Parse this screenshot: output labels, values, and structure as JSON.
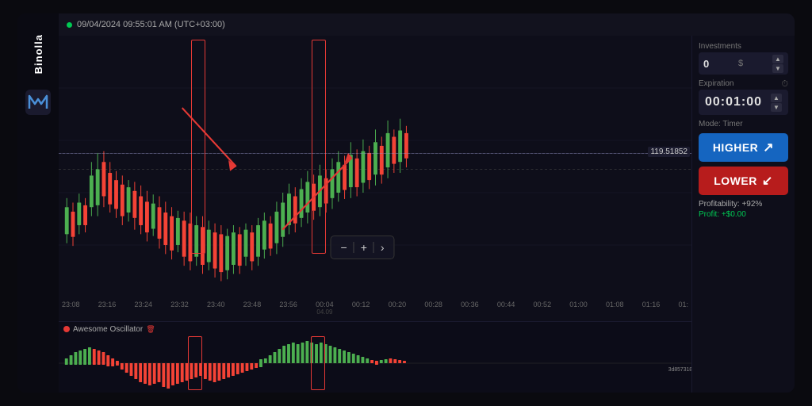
{
  "brand": {
    "name": "Binolla",
    "logo_unicode": "🅼"
  },
  "header": {
    "timestamp": "09/04/2024 09:55:01 AM (UTC+03:00)"
  },
  "chart": {
    "price_label": "119.51852",
    "time_labels": [
      "23:08",
      "23:16",
      "23:24",
      "23:32",
      "23:40",
      "23:48",
      "23:56",
      "00:04",
      "00:12",
      "00:20",
      "00:28",
      "00:36",
      "00:44",
      "00:52",
      "01:00",
      "01:08",
      "01:16",
      "01:"
    ],
    "date_under": "04.09"
  },
  "toolbar": {
    "minus": "−",
    "plus": "+",
    "arrow": "›"
  },
  "oscillator": {
    "title": "Awesome Oscillator"
  },
  "panel": {
    "investments_label": "Investments",
    "investments_value": "0",
    "investments_currency": "$",
    "expiration_label": "Expiration",
    "timer_value": "00:01:00",
    "mode_label": "Mode: Timer",
    "higher_label": "HIGHER",
    "lower_label": "LOWER",
    "profitability_label": "Profitability: +92%",
    "profit_label": "Profit: +$0.00"
  },
  "colors": {
    "higher_bg": "#1565c0",
    "lower_bg": "#b71c1c",
    "candle_bull": "#4caf50",
    "candle_bear": "#f44336",
    "red_marker": "#e53935"
  }
}
